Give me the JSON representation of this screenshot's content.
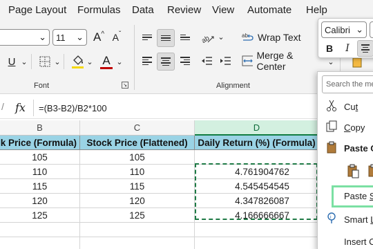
{
  "menu": {
    "tabs": [
      "Page Layout",
      "Formulas",
      "Data",
      "Review",
      "View",
      "Automate",
      "Help"
    ]
  },
  "ribbon": {
    "font_size": "11",
    "grow_font_label": "A",
    "shrink_font_label": "A",
    "underline_label": "U",
    "font_color_label": "A",
    "font_color": "#c00000",
    "font_group_label": "Font",
    "wrap_text_label": "Wrap Text",
    "merge_center_label": "Merge & Center",
    "alignment_group_label": "Alignment"
  },
  "formula_bar": {
    "fx_label": "fx",
    "formula": "=(B3-B2)/B2*100"
  },
  "grid": {
    "columns": [
      "B",
      "C",
      "D"
    ],
    "active_column": "D",
    "headers": [
      "k Price (Formula)",
      "Stock Price (Flattened)",
      "Daily Return (%) (Formula)"
    ],
    "rows": [
      [
        "105",
        "105",
        ""
      ],
      [
        "110",
        "110",
        "4.761904762"
      ],
      [
        "115",
        "115",
        "4.545454545"
      ],
      [
        "120",
        "120",
        "4.347826087"
      ],
      [
        "125",
        "125",
        "4.166666667"
      ]
    ],
    "header_fill": "#9ad3e5",
    "copy_border_color": "#1e7a45"
  },
  "mini_toolbar": {
    "font_name": "Calibri",
    "bold_label": "B",
    "italic_label": "I"
  },
  "context_menu": {
    "search_placeholder": "Search the me",
    "cut_label_main": "Cu",
    "cut_label_accel": "t",
    "copy_label_main": "",
    "copy_label_accel": "C",
    "copy_label_rest": "opy",
    "paste_options_label": "Paste O",
    "paste_special_main": "Paste ",
    "paste_special_accel": "S",
    "paste_special_rest": "p",
    "smart_lookup_main": "Smart ",
    "smart_lookup_accel": "L",
    "insert_label": "Insert C",
    "highlight_color": "#7be0a3"
  }
}
